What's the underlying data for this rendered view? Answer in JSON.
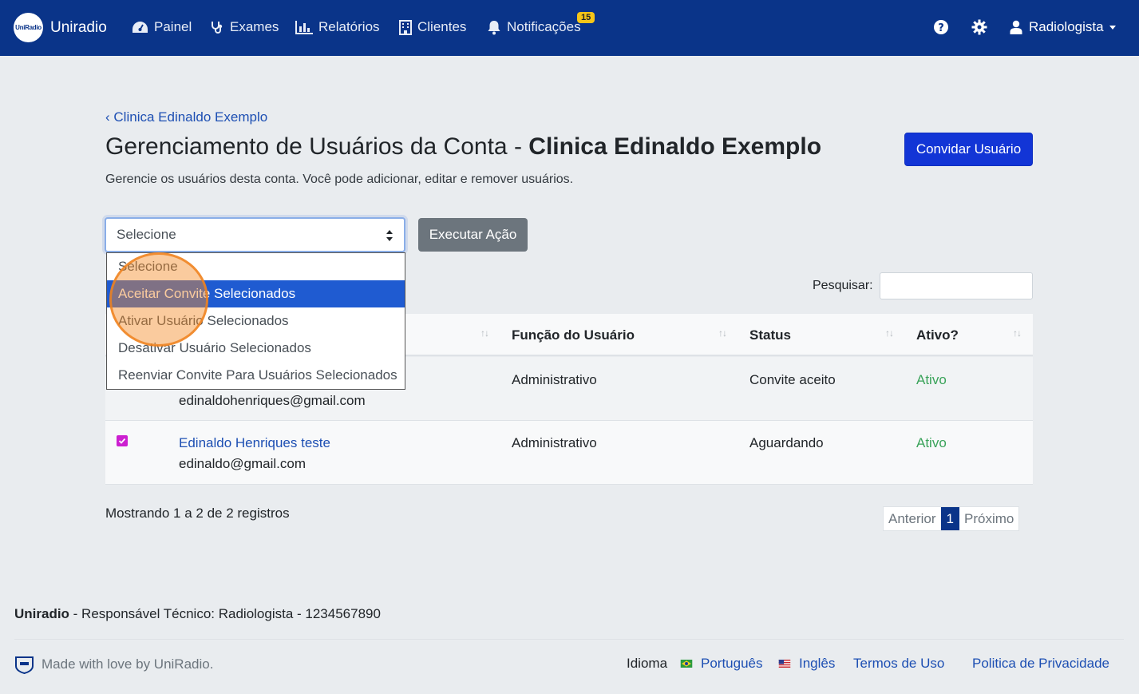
{
  "navbar": {
    "brand": "Uniradio",
    "logo_text": "UniRadio",
    "items": [
      {
        "label": "Painel",
        "icon": "dashboard-icon"
      },
      {
        "label": "Exames",
        "icon": "stethoscope-icon"
      },
      {
        "label": "Relatórios",
        "icon": "bar-chart-icon"
      },
      {
        "label": "Clientes",
        "icon": "building-icon"
      },
      {
        "label": "Notificações",
        "icon": "bell-icon"
      }
    ],
    "notification_count": "15",
    "user": "Radiologista"
  },
  "page": {
    "back_link": "Clinica Edinaldo Exemplo",
    "title_prefix": "Gerenciamento de Usuários da Conta - ",
    "title_account": "Clinica Edinaldo Exemplo",
    "subtitle": "Gerencie os usuários desta conta. Você pode adicionar, editar e remover usuários.",
    "invite_button": "Convidar Usuário"
  },
  "actions": {
    "select_value": "Selecione",
    "execute_button": "Executar Ação",
    "options": [
      "Selecione",
      "Aceitar Convite Selecionados",
      "Ativar Usuário Selecionados",
      "Desativar Usuário Selecionados",
      "Reenviar Convite Para Usuários Selecionados"
    ],
    "highlighted_option": "Aceitar Convite Selecionados"
  },
  "search": {
    "label": "Pesquisar:",
    "value": ""
  },
  "table": {
    "columns": [
      "Função do Usuário",
      "Status",
      "Ativo?"
    ],
    "rows": [
      {
        "name": "",
        "email": "edinaldohenriques@gmail.com",
        "role": "Administrativo",
        "status": "Convite aceito",
        "active": "Ativo",
        "checked": false
      },
      {
        "name": "Edinaldo Henriques teste",
        "email": "edinaldo@gmail.com",
        "role": "Administrativo",
        "status": "Aguardando",
        "active": "Ativo",
        "checked": true
      }
    ]
  },
  "pagination": {
    "showing": "Mostrando 1 a 2 de 2 registros",
    "prev": "Anterior",
    "current": "1",
    "next": "Próximo"
  },
  "footer": {
    "brand": "Uniradio",
    "responsible": " - Responsável Técnico: Radiologista - 1234567890",
    "made_with": "Made with love by UniRadio.",
    "language_label": "Idioma",
    "lang_pt": "Português",
    "lang_en": "Inglês",
    "terms": "Termos de Uso",
    "privacy": "Politica de Privacidade"
  },
  "colors": {
    "navbar": "#0a3489",
    "primary_button": "#1235d6",
    "active_text": "#3aa35a",
    "highlight": "#f58c28"
  }
}
